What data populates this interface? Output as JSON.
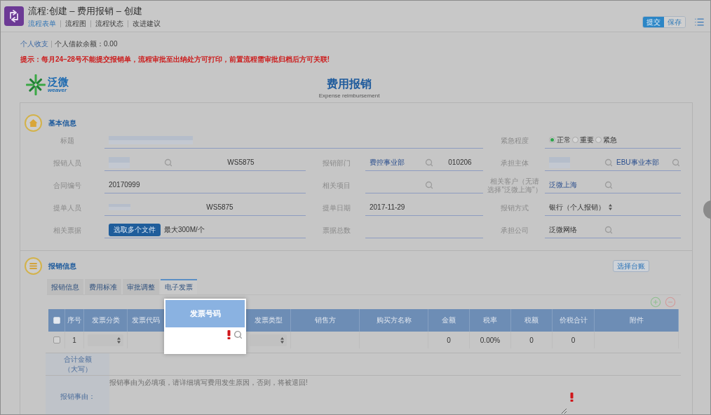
{
  "window": {
    "title": "流程:创建 – 费用报销 – 创建"
  },
  "nav_tabs": [
    {
      "label": "流程表单",
      "selected": true
    },
    {
      "label": "流程图",
      "selected": false
    },
    {
      "label": "流程状态",
      "selected": false
    },
    {
      "label": "改进建议",
      "selected": false
    }
  ],
  "actions": [
    {
      "label": "提交",
      "kind": "primary"
    },
    {
      "label": "保存",
      "kind": "secondary"
    }
  ],
  "balance": {
    "link": "个人收支",
    "text": "个人借款余额：0.00"
  },
  "notice": "提示：每月24–28号不能提交报销单，流程审批至出纳处方可打印，前置流程需审批归档后方可关联!",
  "logo": {
    "name": "泛微",
    "tagline": "weaver"
  },
  "form_header": {
    "title": "费用报销",
    "subtitle": "Expense reimbursement"
  },
  "basic_info": {
    "heading": "基本信息",
    "rows": [
      {
        "fields": [
          {
            "label": "标题",
            "parts": [
              {
                "kind": "redacted"
              }
            ]
          },
          {
            "label": "紧急程度",
            "parts": [
              {
                "kind": "radios",
                "options": [
                  {
                    "label": "正常",
                    "selected": true
                  },
                  {
                    "label": "重要",
                    "selected": false
                  },
                  {
                    "label": "紧急",
                    "selected": false
                  }
                ]
              }
            ]
          }
        ]
      },
      {
        "fields": [
          {
            "label": "报销人员",
            "parts": [
              {
                "kind": "browse",
                "redacted": true
              },
              {
                "kind": "code",
                "text": "WS5875"
              }
            ]
          },
          {
            "label": "报销部门",
            "parts": [
              {
                "kind": "browse",
                "text": "费控事业部",
                "linked": true
              },
              {
                "kind": "code",
                "text": "010206"
              }
            ]
          },
          {
            "label": "承担主体",
            "parts": [
              {
                "kind": "browse",
                "redacted": true
              },
              {
                "kind": "browse",
                "text": "EBU事业本部",
                "linked": true
              }
            ]
          }
        ]
      },
      {
        "fields": [
          {
            "label": "合同编号",
            "parts": [
              {
                "kind": "text",
                "text": "20170999"
              }
            ]
          },
          {
            "label": "相关项目",
            "parts": [
              {
                "kind": "browse"
              }
            ]
          },
          {
            "label": "相关客户（无请选择\"泛微上海\"）",
            "parts": [
              {
                "kind": "browse",
                "text": "泛微上海",
                "linked": true
              }
            ]
          }
        ]
      },
      {
        "fields": [
          {
            "label": "提单人员",
            "parts": [
              {
                "kind": "redacted"
              },
              {
                "kind": "code",
                "text": "WS5875"
              }
            ]
          },
          {
            "label": "提单日期",
            "parts": [
              {
                "kind": "text",
                "text": "2017-11-29"
              }
            ]
          },
          {
            "label": "报销方式",
            "parts": [
              {
                "kind": "select",
                "text": "银行（个人报销）"
              }
            ]
          }
        ]
      },
      {
        "fields": [
          {
            "label": "相关票据",
            "parts": [
              {
                "kind": "file_button",
                "label": "选取多个文件"
              },
              {
                "kind": "hint",
                "text": "最大300M/个"
              }
            ]
          },
          {
            "label": "票据总数"
          },
          {
            "label": "承担公司",
            "parts": [
              {
                "kind": "browse",
                "text": "泛微网络",
                "linked": false
              }
            ]
          }
        ]
      }
    ]
  },
  "expense_info": {
    "heading": "报销信息",
    "ledger_button": "选择台账",
    "tabs": [
      {
        "label": "报销信息",
        "selected": false
      },
      {
        "label": "费用标准",
        "selected": false
      },
      {
        "label": "审批调整",
        "selected": false
      },
      {
        "label": "电子发票",
        "selected": true
      }
    ],
    "table": {
      "columns": [
        {
          "kind": "checkbox",
          "checked": false
        },
        {
          "kind": "text",
          "label": "序号"
        },
        {
          "kind": "text",
          "label": "发票分类"
        },
        {
          "kind": "text",
          "label": "发票代码"
        },
        {
          "kind": "spotlight",
          "label": "发票号码",
          "required": true
        },
        {
          "kind": "text",
          "label": "发票类型"
        },
        {
          "kind": "text",
          "label": "销售方"
        },
        {
          "kind": "text",
          "label": "购买方名称"
        },
        {
          "kind": "text",
          "label": "金额"
        },
        {
          "kind": "text",
          "label": "税率"
        },
        {
          "kind": "text",
          "label": "税额"
        },
        {
          "kind": "text",
          "label": "价税合计"
        },
        {
          "kind": "text",
          "label": "附件"
        }
      ],
      "rows": [
        {
          "cells": [
            {
              "kind": "checkbox",
              "checked": false
            },
            {
              "kind": "text",
              "text": "1"
            },
            {
              "kind": "select"
            },
            {
              "kind": "blank"
            },
            {
              "kind": "blank"
            },
            {
              "kind": "select"
            },
            {
              "kind": "blank"
            },
            {
              "kind": "blank"
            },
            {
              "kind": "text",
              "text": "0"
            },
            {
              "kind": "text",
              "text": "0.00%"
            },
            {
              "kind": "text",
              "text": "0"
            },
            {
              "kind": "text",
              "text": "0"
            },
            {
              "kind": "blank"
            }
          ]
        }
      ]
    },
    "summary": [
      {
        "kind": "amount",
        "label": "合计金额（大写）"
      },
      {
        "kind": "textarea",
        "label": "报销事由：",
        "placeholder": "报销事由为必填项，请详细填写费用发生原因，否则，将被退回!",
        "required": true
      }
    ]
  }
}
